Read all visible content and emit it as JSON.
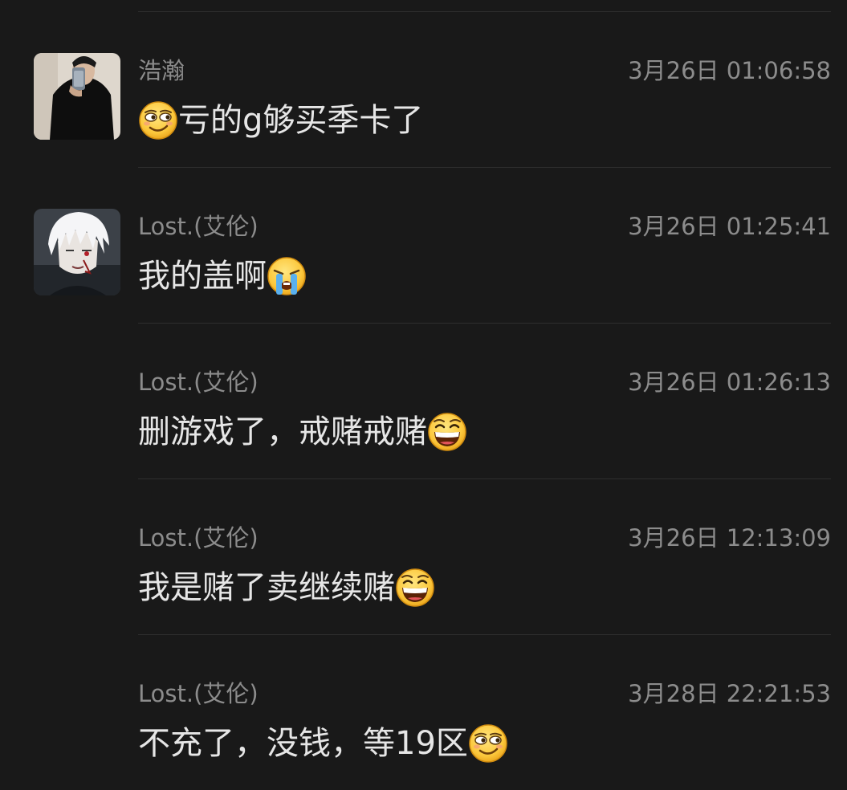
{
  "messages": [
    {
      "sender": "浩瀚",
      "time": "3月26日 01:06:58",
      "text_before": "",
      "text_after": "亏的g够买季卡了",
      "emoji": "smirk-face-icon",
      "avatar": "person-dark-avatar"
    },
    {
      "sender": "Lost.(艾伦)",
      "time": "3月26日 01:25:41",
      "text_before": "我的盖啊",
      "text_after": "",
      "emoji": "crying-face-icon",
      "avatar": "white-hair-anime-avatar"
    },
    {
      "sender": "Lost.(艾伦)",
      "time": "3月26日 01:26:13",
      "text_before": "删游戏了，戒赌戒赌",
      "text_after": "",
      "emoji": "grin-face-icon"
    },
    {
      "sender": "Lost.(艾伦)",
      "time": "3月26日 12:13:09",
      "text_before": "我是赌了卖继续赌",
      "text_after": "",
      "emoji": "grin-face-icon"
    },
    {
      "sender": "Lost.(艾伦)",
      "time": "3月28日 22:21:53",
      "text_before": "不充了，没钱，等19区",
      "text_after": "",
      "emoji": "smirk-face-icon"
    }
  ],
  "colors": {
    "background": "#191919",
    "divider": "#2e2e2e",
    "meta_text": "#8c8c8c",
    "message_text": "#e6e6e6"
  }
}
